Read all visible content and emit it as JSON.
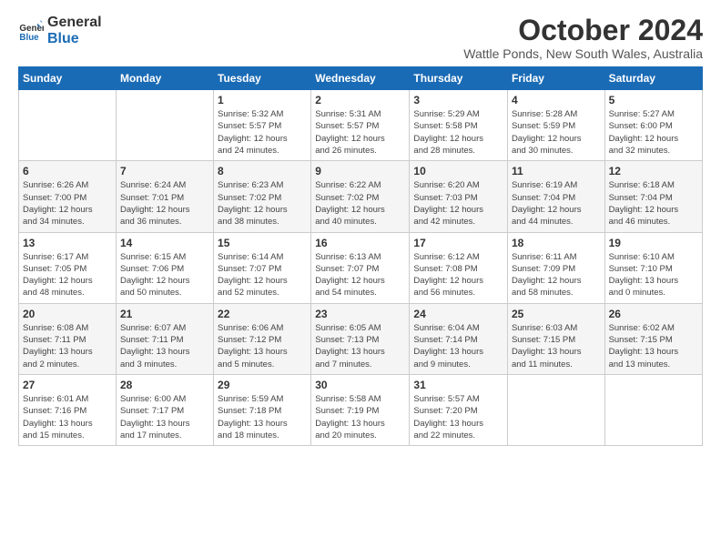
{
  "logo": {
    "line1": "General",
    "line2": "Blue"
  },
  "title": "October 2024",
  "location": "Wattle Ponds, New South Wales, Australia",
  "days_header": [
    "Sunday",
    "Monday",
    "Tuesday",
    "Wednesday",
    "Thursday",
    "Friday",
    "Saturday"
  ],
  "weeks": [
    [
      {
        "day": "",
        "info": ""
      },
      {
        "day": "",
        "info": ""
      },
      {
        "day": "1",
        "info": "Sunrise: 5:32 AM\nSunset: 5:57 PM\nDaylight: 12 hours\nand 24 minutes."
      },
      {
        "day": "2",
        "info": "Sunrise: 5:31 AM\nSunset: 5:57 PM\nDaylight: 12 hours\nand 26 minutes."
      },
      {
        "day": "3",
        "info": "Sunrise: 5:29 AM\nSunset: 5:58 PM\nDaylight: 12 hours\nand 28 minutes."
      },
      {
        "day": "4",
        "info": "Sunrise: 5:28 AM\nSunset: 5:59 PM\nDaylight: 12 hours\nand 30 minutes."
      },
      {
        "day": "5",
        "info": "Sunrise: 5:27 AM\nSunset: 6:00 PM\nDaylight: 12 hours\nand 32 minutes."
      }
    ],
    [
      {
        "day": "6",
        "info": "Sunrise: 6:26 AM\nSunset: 7:00 PM\nDaylight: 12 hours\nand 34 minutes."
      },
      {
        "day": "7",
        "info": "Sunrise: 6:24 AM\nSunset: 7:01 PM\nDaylight: 12 hours\nand 36 minutes."
      },
      {
        "day": "8",
        "info": "Sunrise: 6:23 AM\nSunset: 7:02 PM\nDaylight: 12 hours\nand 38 minutes."
      },
      {
        "day": "9",
        "info": "Sunrise: 6:22 AM\nSunset: 7:02 PM\nDaylight: 12 hours\nand 40 minutes."
      },
      {
        "day": "10",
        "info": "Sunrise: 6:20 AM\nSunset: 7:03 PM\nDaylight: 12 hours\nand 42 minutes."
      },
      {
        "day": "11",
        "info": "Sunrise: 6:19 AM\nSunset: 7:04 PM\nDaylight: 12 hours\nand 44 minutes."
      },
      {
        "day": "12",
        "info": "Sunrise: 6:18 AM\nSunset: 7:04 PM\nDaylight: 12 hours\nand 46 minutes."
      }
    ],
    [
      {
        "day": "13",
        "info": "Sunrise: 6:17 AM\nSunset: 7:05 PM\nDaylight: 12 hours\nand 48 minutes."
      },
      {
        "day": "14",
        "info": "Sunrise: 6:15 AM\nSunset: 7:06 PM\nDaylight: 12 hours\nand 50 minutes."
      },
      {
        "day": "15",
        "info": "Sunrise: 6:14 AM\nSunset: 7:07 PM\nDaylight: 12 hours\nand 52 minutes."
      },
      {
        "day": "16",
        "info": "Sunrise: 6:13 AM\nSunset: 7:07 PM\nDaylight: 12 hours\nand 54 minutes."
      },
      {
        "day": "17",
        "info": "Sunrise: 6:12 AM\nSunset: 7:08 PM\nDaylight: 12 hours\nand 56 minutes."
      },
      {
        "day": "18",
        "info": "Sunrise: 6:11 AM\nSunset: 7:09 PM\nDaylight: 12 hours\nand 58 minutes."
      },
      {
        "day": "19",
        "info": "Sunrise: 6:10 AM\nSunset: 7:10 PM\nDaylight: 13 hours\nand 0 minutes."
      }
    ],
    [
      {
        "day": "20",
        "info": "Sunrise: 6:08 AM\nSunset: 7:11 PM\nDaylight: 13 hours\nand 2 minutes."
      },
      {
        "day": "21",
        "info": "Sunrise: 6:07 AM\nSunset: 7:11 PM\nDaylight: 13 hours\nand 3 minutes."
      },
      {
        "day": "22",
        "info": "Sunrise: 6:06 AM\nSunset: 7:12 PM\nDaylight: 13 hours\nand 5 minutes."
      },
      {
        "day": "23",
        "info": "Sunrise: 6:05 AM\nSunset: 7:13 PM\nDaylight: 13 hours\nand 7 minutes."
      },
      {
        "day": "24",
        "info": "Sunrise: 6:04 AM\nSunset: 7:14 PM\nDaylight: 13 hours\nand 9 minutes."
      },
      {
        "day": "25",
        "info": "Sunrise: 6:03 AM\nSunset: 7:15 PM\nDaylight: 13 hours\nand 11 minutes."
      },
      {
        "day": "26",
        "info": "Sunrise: 6:02 AM\nSunset: 7:15 PM\nDaylight: 13 hours\nand 13 minutes."
      }
    ],
    [
      {
        "day": "27",
        "info": "Sunrise: 6:01 AM\nSunset: 7:16 PM\nDaylight: 13 hours\nand 15 minutes."
      },
      {
        "day": "28",
        "info": "Sunrise: 6:00 AM\nSunset: 7:17 PM\nDaylight: 13 hours\nand 17 minutes."
      },
      {
        "day": "29",
        "info": "Sunrise: 5:59 AM\nSunset: 7:18 PM\nDaylight: 13 hours\nand 18 minutes."
      },
      {
        "day": "30",
        "info": "Sunrise: 5:58 AM\nSunset: 7:19 PM\nDaylight: 13 hours\nand 20 minutes."
      },
      {
        "day": "31",
        "info": "Sunrise: 5:57 AM\nSunset: 7:20 PM\nDaylight: 13 hours\nand 22 minutes."
      },
      {
        "day": "",
        "info": ""
      },
      {
        "day": "",
        "info": ""
      }
    ]
  ]
}
